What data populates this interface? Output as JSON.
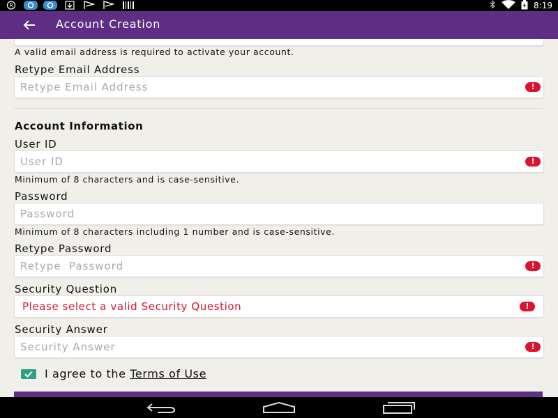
{
  "status_bar": {
    "time": "8:19",
    "left_icons": [
      "r-icon",
      "sync-icon",
      "sync-icon-2",
      "download-icon",
      "flag-icon",
      "flag-icon-2",
      "barcode-icon"
    ],
    "right_icons": [
      "bluetooth-icon",
      "wifi-icon",
      "battery-icon"
    ]
  },
  "app_bar": {
    "title": "Account Creation"
  },
  "form": {
    "email_hint": "A valid email address is required to activate your account.",
    "retype_email": {
      "label": "Retype Email Address",
      "placeholder": "Retype Email Address"
    },
    "section_title": "Account Information",
    "user_id": {
      "label": "User ID",
      "placeholder": "User ID",
      "hint": "Minimum of 8 characters and is case-sensitive."
    },
    "password": {
      "label": "Password",
      "placeholder": "Password",
      "hint": "Minimum of 8 characters including 1 number and is case-sensitive."
    },
    "retype_password": {
      "label": "Retype Password",
      "placeholder": "Retype  Password"
    },
    "security_question": {
      "label": "Security Question",
      "value": "Please select a valid Security Question"
    },
    "security_answer": {
      "label": "Security Answer",
      "placeholder": "Security Answer"
    },
    "agree": {
      "prefix": "I agree to the ",
      "link": "Terms of Use",
      "checked": true
    },
    "error_glyph": "!"
  },
  "colors": {
    "app_bar": "#5e2d84",
    "error": "#e0102f",
    "checkbox": "#2aa182",
    "background": "#f1efe9"
  },
  "nav_bar": {
    "buttons": [
      "back-icon",
      "home-icon",
      "recents-icon"
    ]
  }
}
